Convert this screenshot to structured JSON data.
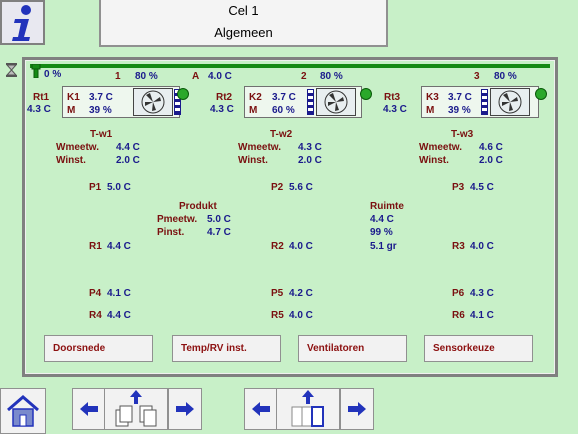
{
  "header": {
    "title": "Cel 1",
    "subtitle": "Algemeen"
  },
  "topbar": {
    "start_pct": "0 %",
    "temp_label": "A",
    "temp_value": "4.0 C"
  },
  "units": [
    {
      "rt": "Rt1",
      "rt_val": "4.3 C",
      "k": "K1",
      "k_val": "3.7 C",
      "m": "M",
      "m_val": "39 %",
      "num": "1",
      "pct": "80 %",
      "tw": "T-w1",
      "wmeet_label": "Wmeetw.",
      "wmeet": "4.4 C",
      "winst_label": "Winst.",
      "winst": "2.0 C"
    },
    {
      "rt": "Rt2",
      "rt_val": "4.3 C",
      "k": "K2",
      "k_val": "3.7 C",
      "m": "M",
      "m_val": "60 %",
      "num": "2",
      "pct": "80 %",
      "tw": "T-w2",
      "wmeet_label": "Wmeetw.",
      "wmeet": "4.3 C",
      "winst_label": "Winst.",
      "winst": "2.0 C"
    },
    {
      "rt": "Rt3",
      "rt_val": "4.3 C",
      "k": "K3",
      "k_val": "3.7 C",
      "m": "M",
      "m_val": "39 %",
      "num": "3",
      "pct": "80 %",
      "tw": "T-w3",
      "wmeet_label": "Wmeetw.",
      "wmeet": "4.6 C",
      "winst_label": "Winst.",
      "winst": "2.0 C"
    }
  ],
  "probes": {
    "p1": {
      "label": "P1",
      "value": "5.0 C"
    },
    "p2": {
      "label": "P2",
      "value": "5.6 C"
    },
    "p3": {
      "label": "P3",
      "value": "4.5 C"
    },
    "r1": {
      "label": "R1",
      "value": "4.4 C"
    },
    "r2": {
      "label": "R2",
      "value": "4.0 C"
    },
    "r3": {
      "label": "R3",
      "value": "4.0 C"
    },
    "p4": {
      "label": "P4",
      "value": "4.1 C"
    },
    "p5": {
      "label": "P5",
      "value": "4.2 C"
    },
    "p6": {
      "label": "P6",
      "value": "4.3 C"
    },
    "r4": {
      "label": "R4",
      "value": "4.4 C"
    },
    "r5": {
      "label": "R5",
      "value": "4.0 C"
    },
    "r6": {
      "label": "R6",
      "value": "4.1 C"
    }
  },
  "produkt": {
    "title": "Produkt",
    "pmeet_label": "Pmeetw.",
    "pmeet": "5.0 C",
    "pinst_label": "Pinst.",
    "pinst": "4.7 C"
  },
  "ruimte": {
    "title": "Ruimte",
    "temp": "4.4 C",
    "rv": "99 %",
    "gr": "5.1 gr"
  },
  "buttons": {
    "doorsnede": "Doorsnede",
    "temp_rv": "Temp/RV inst.",
    "ventilatoren": "Ventilatoren",
    "sensorkeuze": "Sensorkeuze"
  },
  "colors": {
    "background": "#c8f0c8",
    "value_blue": "#1a1a8c",
    "label_red": "#8c1010",
    "fan_on": "#2aa82a"
  }
}
